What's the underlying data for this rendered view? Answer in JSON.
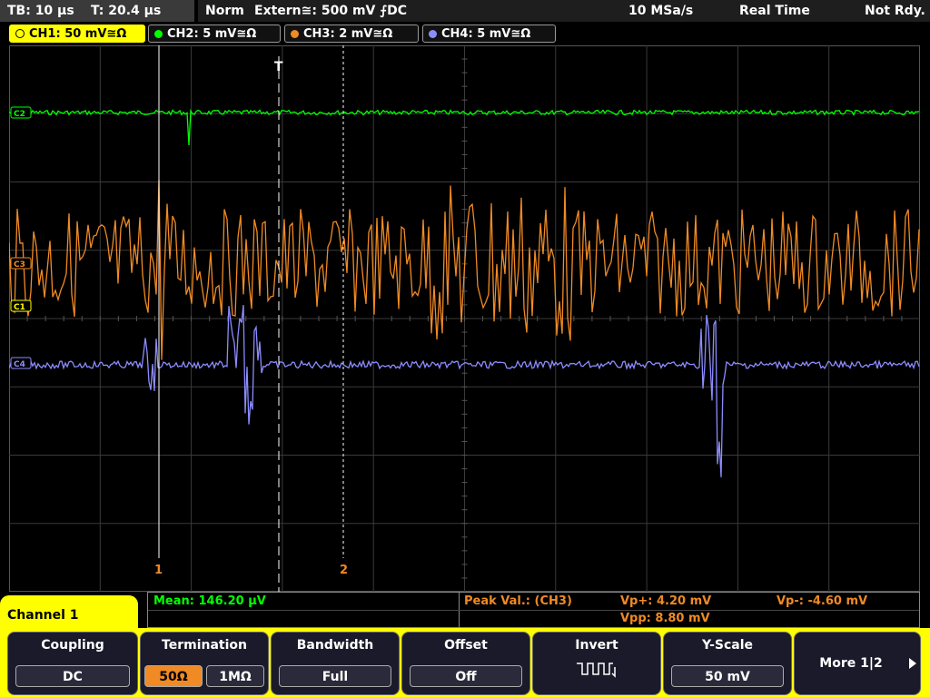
{
  "status": {
    "timebase": "TB: 10 µs",
    "trigger_time": "T: 20.4 µs",
    "mode": "Norm",
    "trigger": "Extern≅: 500 mV ⨍DC",
    "sample_rate": "10 MSa/s",
    "acq": "Real Time",
    "ready": "Not Rdy."
  },
  "channels": [
    {
      "label": "CH1: 50 mV≅Ω",
      "color": "#ffff00"
    },
    {
      "label": "CH2: 5 mV≅Ω",
      "color": "#00ff00"
    },
    {
      "label": "CH3: 2 mV≅Ω",
      "color": "#f08a24"
    },
    {
      "label": "CH4: 5 mV≅Ω",
      "color": "#8c8cff"
    }
  ],
  "markers": {
    "ch2": "C2",
    "ch3": "C3",
    "ch1": "C1",
    "ch4": "C4",
    "trigger": "T",
    "cursor1": "1",
    "cursor2": "2"
  },
  "measurements": {
    "mean": "Mean: 146.20 µV",
    "peak": "Peak Val.:  (CH3)",
    "vp_plus": "Vp+: 4.20 mV",
    "vp_minus": "Vp-: -4.60 mV",
    "vpp": "Vpp: 8.80 mV"
  },
  "panel": {
    "title": "Channel 1",
    "coupling": {
      "title": "Coupling",
      "value": "DC"
    },
    "termination": {
      "title": "Termination",
      "opt1": "50Ω",
      "opt2": "1MΩ"
    },
    "bandwidth": {
      "title": "Bandwidth",
      "value": "Full"
    },
    "offset": {
      "title": "Offset",
      "value": "Off"
    },
    "invert": {
      "title": "Invert"
    },
    "yscale": {
      "title": "Y-Scale",
      "value": "50 mV"
    },
    "more": "More 1|2"
  }
}
